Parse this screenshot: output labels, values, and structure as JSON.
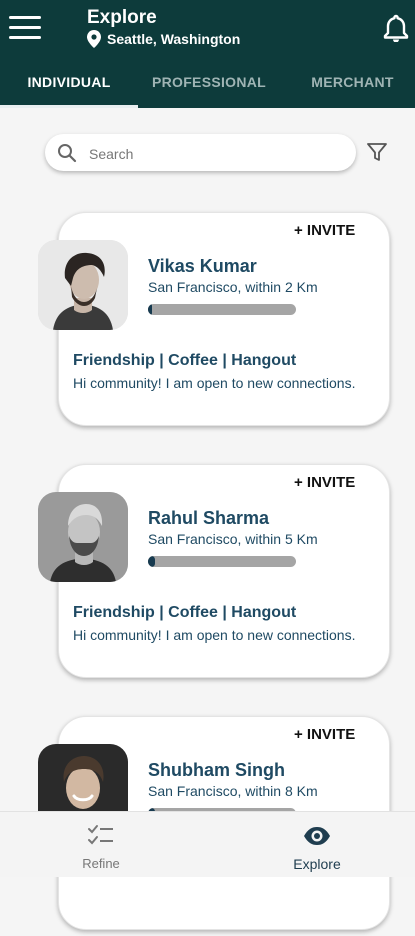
{
  "header": {
    "title": "Explore",
    "location": "Seattle, Washington"
  },
  "tabs": [
    {
      "label": "INDIVIDUAL",
      "active": true
    },
    {
      "label": "PROFESSIONAL",
      "active": false
    },
    {
      "label": "MERCHANT",
      "active": false
    }
  ],
  "search": {
    "placeholder": "Search",
    "value": ""
  },
  "cards": [
    {
      "invite_label": "+ INVITE",
      "name": "Vikas Kumar",
      "distance": "San Francisco, within 2 Km",
      "progress": 0.03,
      "interests": "Friendship | Coffee | Hangout",
      "bio": "Hi community! I am open to new connections."
    },
    {
      "invite_label": "+ INVITE",
      "name": "Rahul Sharma",
      "distance": "San Francisco, within 5 Km",
      "progress": 0.05,
      "interests": "Friendship | Coffee | Hangout",
      "bio": "Hi community! I am open to new connections."
    },
    {
      "invite_label": "+ INVITE",
      "name": "Shubham Singh",
      "distance": "San Francisco, within 8 Km",
      "progress": 0.05,
      "interests": "",
      "bio": ""
    }
  ],
  "bottom_nav": [
    {
      "label": "Refine",
      "icon": "checklist-icon",
      "active": false
    },
    {
      "label": "Explore",
      "icon": "eye-icon",
      "active": true
    }
  ],
  "colors": {
    "header_bg": "#0d3b3b",
    "text_primary": "#1f4a63",
    "bar_track": "#a5a5a5",
    "bar_fill": "#173a4f"
  }
}
